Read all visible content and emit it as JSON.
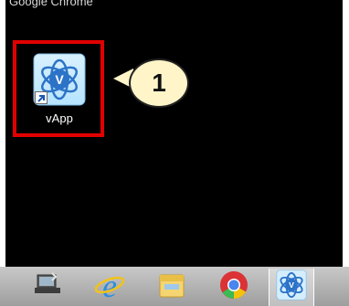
{
  "desktop": {
    "partial_top_label": "Google Chrome",
    "shortcut": {
      "label": "vApp",
      "icon": "vapp-icon"
    },
    "callout": {
      "number": "1"
    },
    "highlight_color": "#e10000",
    "callout_fill": "#fff5c8"
  },
  "taskbar": {
    "items": [
      {
        "name": "remote-desktop-icon",
        "active": false
      },
      {
        "name": "internet-explorer-icon",
        "active": false
      },
      {
        "name": "file-explorer-icon",
        "active": false
      },
      {
        "name": "chrome-icon",
        "active": false
      },
      {
        "name": "vapp-icon",
        "active": true
      }
    ]
  }
}
